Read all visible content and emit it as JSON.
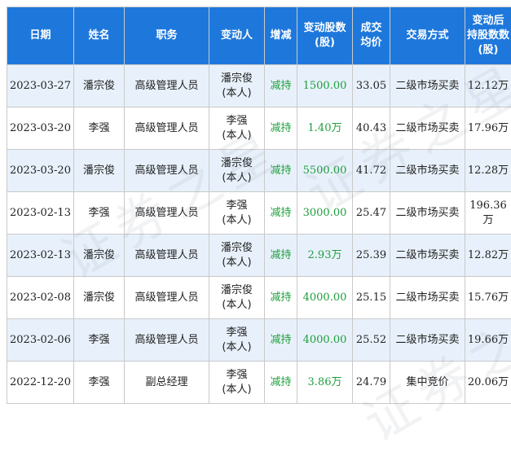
{
  "table": {
    "headers": {
      "date": "日期",
      "name": "姓名",
      "position": "职务",
      "changer": "变动人",
      "direction": "增减",
      "shares_l1": "变动股数",
      "shares_l2": "(股)",
      "price_l1": "成交",
      "price_l2": "均价",
      "method": "交易方式",
      "holding_l1": "变动后",
      "holding_l2": "持股数数",
      "holding_l3": "(股)"
    },
    "rows": [
      {
        "date": "2023-03-27",
        "name": "潘宗俊",
        "position": "高级管理人员",
        "changer": "潘宗俊",
        "relation": "(本人)",
        "direction": "减持",
        "shares": "1500.00",
        "price": "33.05",
        "method": "二级市场买卖",
        "holding": "12.12万"
      },
      {
        "date": "2023-03-20",
        "name": "李强",
        "position": "高级管理人员",
        "changer": "李强",
        "relation": "(本人)",
        "direction": "减持",
        "shares": "1.40万",
        "price": "40.43",
        "method": "二级市场买卖",
        "holding": "17.96万"
      },
      {
        "date": "2023-03-20",
        "name": "潘宗俊",
        "position": "高级管理人员",
        "changer": "潘宗俊",
        "relation": "(本人)",
        "direction": "减持",
        "shares": "5500.00",
        "price": "41.72",
        "method": "二级市场买卖",
        "holding": "12.28万"
      },
      {
        "date": "2023-02-13",
        "name": "李强",
        "position": "高级管理人员",
        "changer": "李强",
        "relation": "(本人)",
        "direction": "减持",
        "shares": "3000.00",
        "price": "25.47",
        "method": "二级市场买卖",
        "holding": "196.36万"
      },
      {
        "date": "2023-02-13",
        "name": "潘宗俊",
        "position": "高级管理人员",
        "changer": "潘宗俊",
        "relation": "(本人)",
        "direction": "减持",
        "shares": "2.93万",
        "price": "25.39",
        "method": "二级市场买卖",
        "holding": "12.82万"
      },
      {
        "date": "2023-02-08",
        "name": "潘宗俊",
        "position": "高级管理人员",
        "changer": "潘宗俊",
        "relation": "(本人)",
        "direction": "减持",
        "shares": "4000.00",
        "price": "25.15",
        "method": "二级市场买卖",
        "holding": "15.76万"
      },
      {
        "date": "2023-02-06",
        "name": "李强",
        "position": "高级管理人员",
        "changer": "李强",
        "relation": "(本人)",
        "direction": "减持",
        "shares": "4000.00",
        "price": "25.52",
        "method": "二级市场买卖",
        "holding": "19.66万"
      },
      {
        "date": "2022-12-20",
        "name": "李强",
        "position": "副总经理",
        "changer": "李强",
        "relation": "(本人)",
        "direction": "减持",
        "shares": "3.86万",
        "price": "24.79",
        "method": "集中竞价",
        "holding": "20.06万"
      }
    ]
  },
  "watermark": "证券之星",
  "colors": {
    "header_bg": "#1e78dc",
    "header_text": "#ffffff",
    "row_stripe": "#e8f1fb",
    "decrease": "#1e9e3c"
  }
}
